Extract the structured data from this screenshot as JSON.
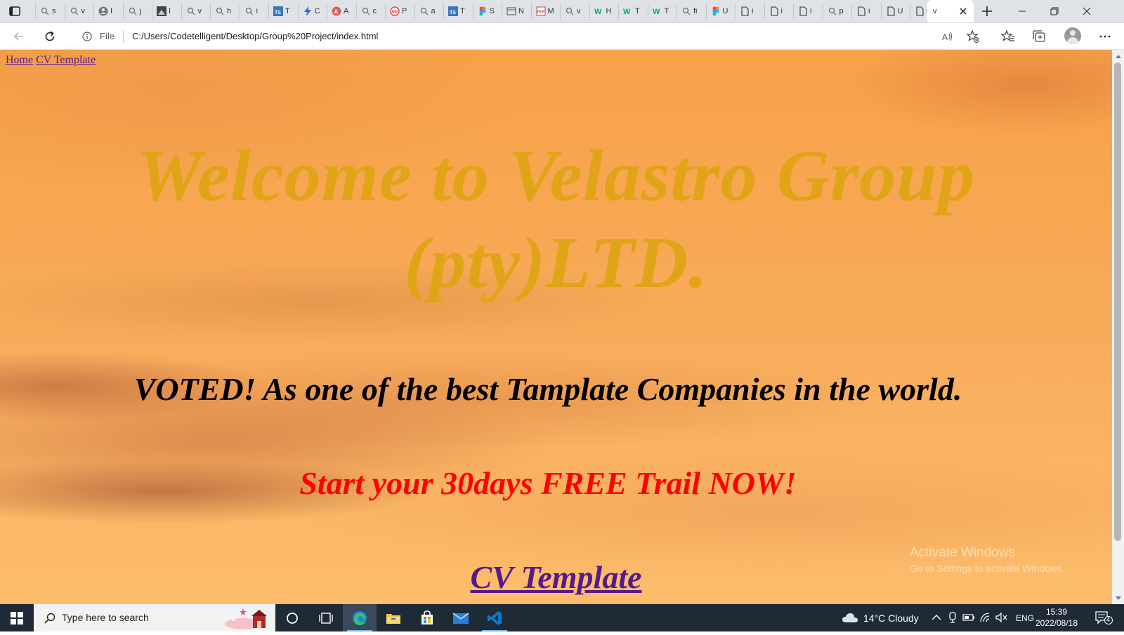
{
  "browser": {
    "tabs": [
      {
        "icon": "search-icon",
        "text": "s"
      },
      {
        "icon": "search-icon",
        "text": "v"
      },
      {
        "icon": "account-icon",
        "text": "I"
      },
      {
        "icon": "search-icon",
        "text": "j"
      },
      {
        "icon": "image-icon",
        "text": "I"
      },
      {
        "icon": "search-icon",
        "text": "v"
      },
      {
        "icon": "search-icon",
        "text": "h"
      },
      {
        "icon": "search-icon",
        "text": "i"
      },
      {
        "icon": "typescript-icon",
        "text": "T"
      },
      {
        "icon": "lightning-icon",
        "text": "C"
      },
      {
        "icon": "angular-icon",
        "text": "A"
      },
      {
        "icon": "search-icon",
        "text": "c"
      },
      {
        "icon": "mw-icon",
        "text": "P"
      },
      {
        "icon": "search-icon",
        "text": "a"
      },
      {
        "icon": "typescript-icon",
        "text": "T"
      },
      {
        "icon": "figma-icon",
        "text": "S"
      },
      {
        "icon": "window-icon",
        "text": "N"
      },
      {
        "icon": "pdf-icon",
        "text": "M"
      },
      {
        "icon": "search-icon",
        "text": "v"
      },
      {
        "icon": "w3-icon",
        "text": "H"
      },
      {
        "icon": "w3-icon",
        "text": "T"
      },
      {
        "icon": "w3-icon",
        "text": "T"
      },
      {
        "icon": "search-icon",
        "text": "fi"
      },
      {
        "icon": "figma-icon",
        "text": "U"
      },
      {
        "icon": "page-icon",
        "text": "i"
      },
      {
        "icon": "page-icon",
        "text": "i"
      },
      {
        "icon": "page-icon",
        "text": "i"
      },
      {
        "icon": "search-icon",
        "text": "p"
      },
      {
        "icon": "page-icon",
        "text": "i"
      },
      {
        "icon": "page-icon",
        "text": "U"
      },
      {
        "icon": "page-icon",
        "text": "i"
      }
    ],
    "active_tab": {
      "text": "v"
    },
    "address": {
      "scheme": "File",
      "url": "C:/Users/Codetelligent/Desktop/Group%20Project/index.html"
    }
  },
  "page": {
    "nav": {
      "home": "Home",
      "cv": "CV Template"
    },
    "title_line1": "Welcome to Velastro Group",
    "title_line2": "(pty)LTD.",
    "voted": "VOTED! As one of the best Tamplate Companies in the world.",
    "trial": "Start your 30days FREE Trail NOW!",
    "cv_heading": "CV Template",
    "colors": {
      "title": "#e0a417",
      "voted": "#000000",
      "trial": "#ff0000",
      "link": "#551a8b"
    }
  },
  "watermark": {
    "title": "Activate Windows",
    "subtitle": "Go to Settings to activate Windows."
  },
  "taskbar": {
    "search_placeholder": "Type here to search",
    "weather": "14°C  Cloudy",
    "language": "ENG",
    "time": "15:39",
    "date": "2022/08/18",
    "notification_count": "4",
    "apps": [
      "cortana-icon",
      "task-view-icon",
      "edge-icon",
      "file-explorer-icon",
      "store-icon",
      "mail-icon",
      "vscode-icon"
    ]
  }
}
